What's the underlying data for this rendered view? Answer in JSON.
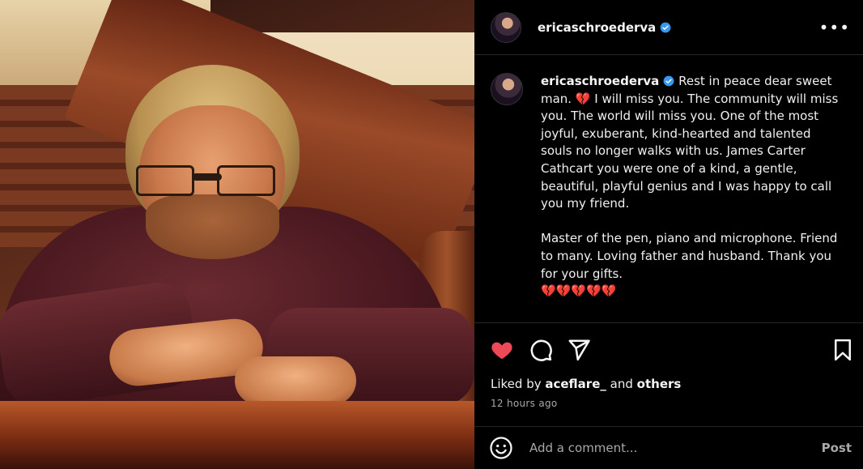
{
  "post": {
    "username": "ericaschroederva",
    "verified": true,
    "caption_paragraphs": [
      "Rest in peace dear sweet man. 💔 I will miss you. The community will miss you. The world will miss you. One of the most joyful, exuberant, kind-hearted and talented souls no longer walks with us. James Carter Cathcart you were one of a kind, a gentle, beautiful, playful genius and I was happy to call you my friend.",
      "Master of the pen, piano and microphone. Friend to many. Loving father and husband. Thank you for your gifts.",
      "💔💔💔💔💔"
    ],
    "liked_by_prefix": "Liked by",
    "liked_by_user": "aceflare_",
    "liked_by_and": "and",
    "liked_by_others": "others",
    "timestamp": "12 hours ago"
  },
  "icons": {
    "more": "more-options-icon",
    "like": "heart-icon",
    "comment": "comment-icon",
    "share": "share-icon",
    "save": "bookmark-icon",
    "emoji": "emoji-icon"
  },
  "comment_box": {
    "placeholder": "Add a comment...",
    "post_label": "Post"
  },
  "colors": {
    "like_active": "#ed4956",
    "verified_badge": "#3897f0",
    "background": "#000000",
    "muted_text": "#a8a8a8"
  }
}
